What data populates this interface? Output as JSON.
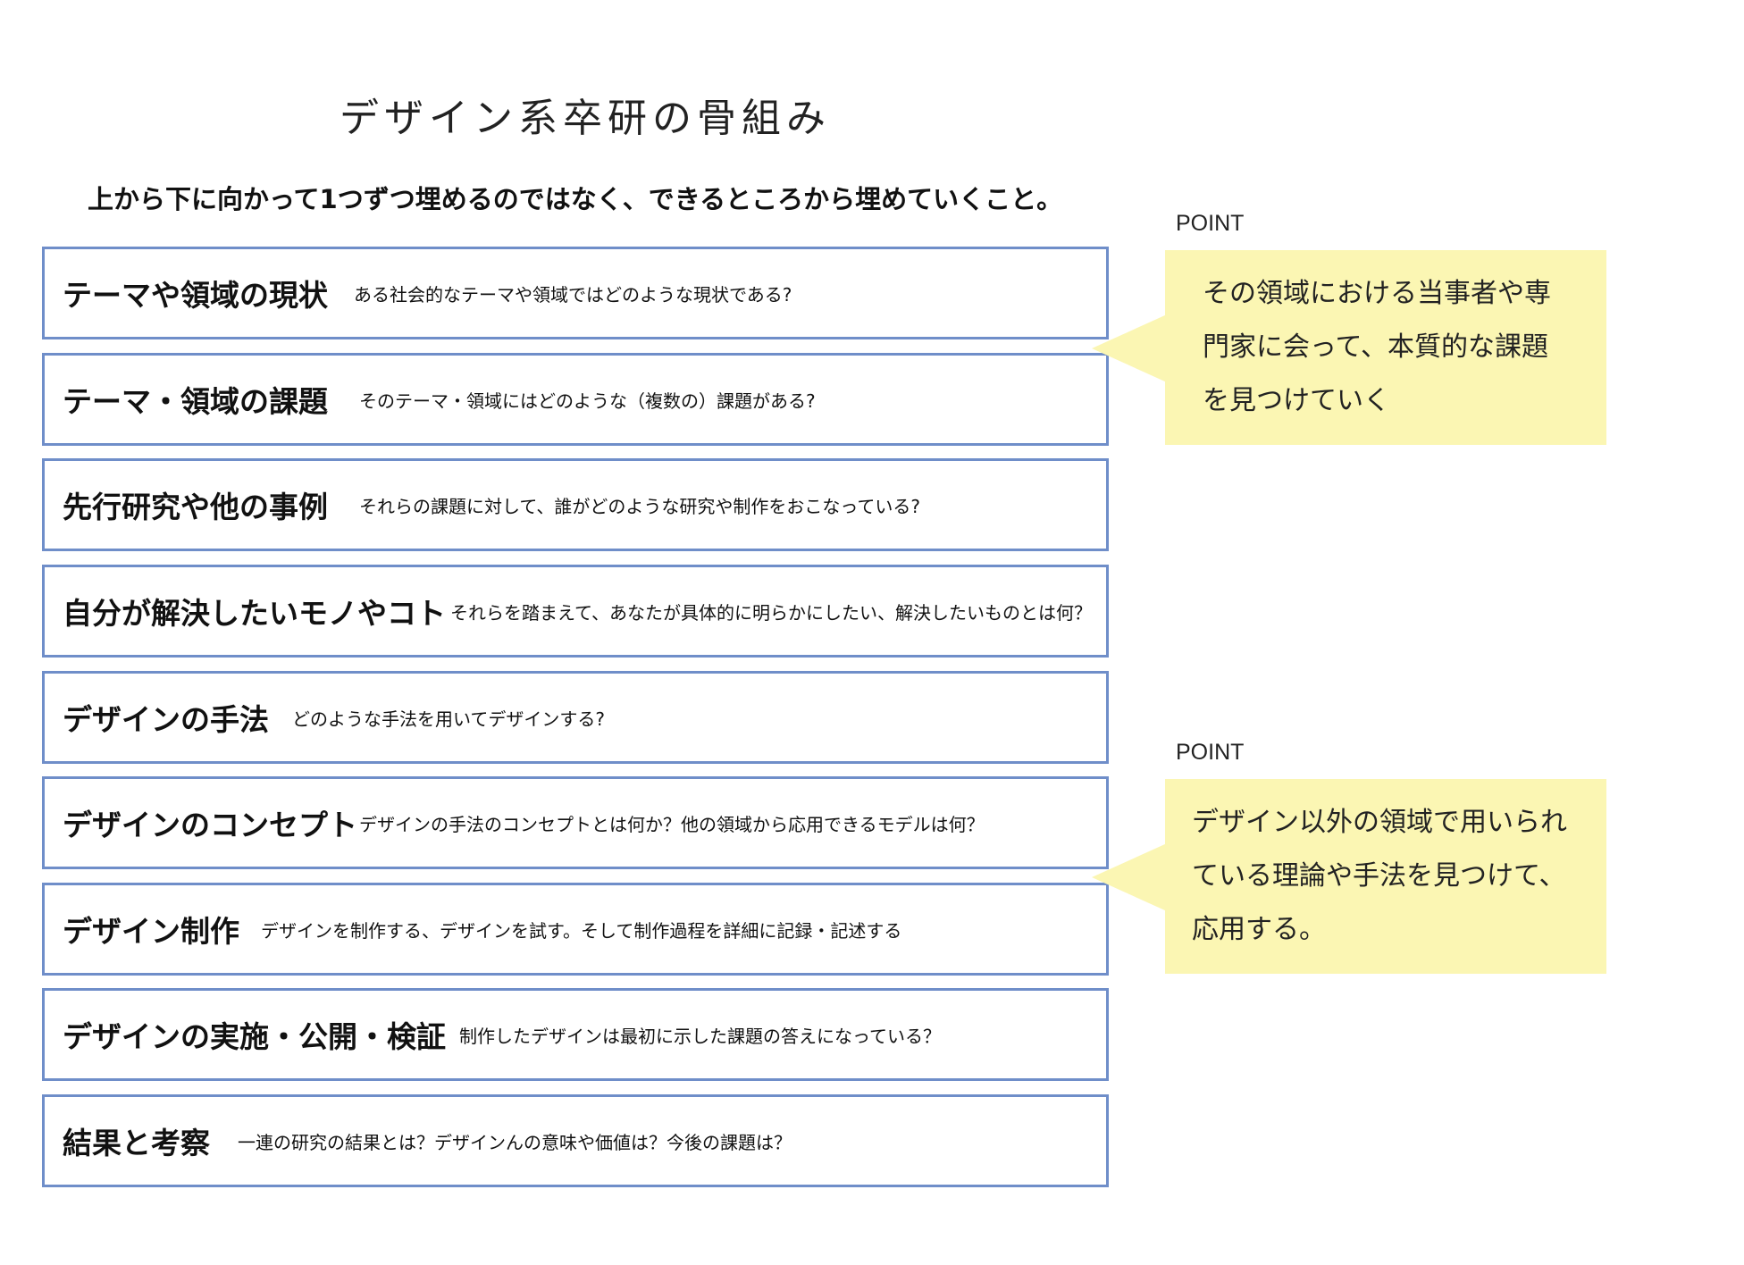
{
  "title": "デザイン系卒研の骨組み",
  "subtitle": "上から下に向かって1つずつ埋めるのではなく、できるところから埋めていくこと。",
  "steps": [
    {
      "title": "テーマや領域の現状",
      "desc": "ある社会的なテーマや領域ではどのような現状である?"
    },
    {
      "title": "テーマ・領域の課題",
      "desc": "そのテーマ・領域にはどのような（複数の）課題がある?"
    },
    {
      "title": "先行研究や他の事例",
      "desc": "それらの課題に対して、誰がどのような研究や制作をおこなっている?"
    },
    {
      "title": "自分が解決したいモノやコト",
      "desc": "それらを踏まえて、あなたが具体的に明らかにしたい、解決したいものとは何？"
    },
    {
      "title": "デザインの手法",
      "desc": "どのような手法を用いてデザインする?"
    },
    {
      "title": "デザインのコンセプト",
      "desc": "デザインの手法のコンセプトとは何か？他の領域から応用できるモデルは何？"
    },
    {
      "title": "デザイン制作",
      "desc": "デザインを制作する、デザインを試す。そして制作過程を詳細に記録・記述する"
    },
    {
      "title": "デザインの実施・公開・検証",
      "desc": "制作したデザインは最初に示した課題の答えになっている？"
    },
    {
      "title": "結果と考察",
      "desc": "一連の研究の結果とは？デザインんの意味や価値は？今後の課題は？"
    }
  ],
  "points": [
    {
      "label": "POINT",
      "text": "その領域における当事者や専\n門家に会って、本質的な課題\nを見つけていく"
    },
    {
      "label": "POINT",
      "text": "デザイン以外の領域で用いられ\nている理論や手法を見つけて、\n応用する。"
    }
  ],
  "colors": {
    "border": "#6f8ec9",
    "callout_bg": "#fbf6b3"
  }
}
